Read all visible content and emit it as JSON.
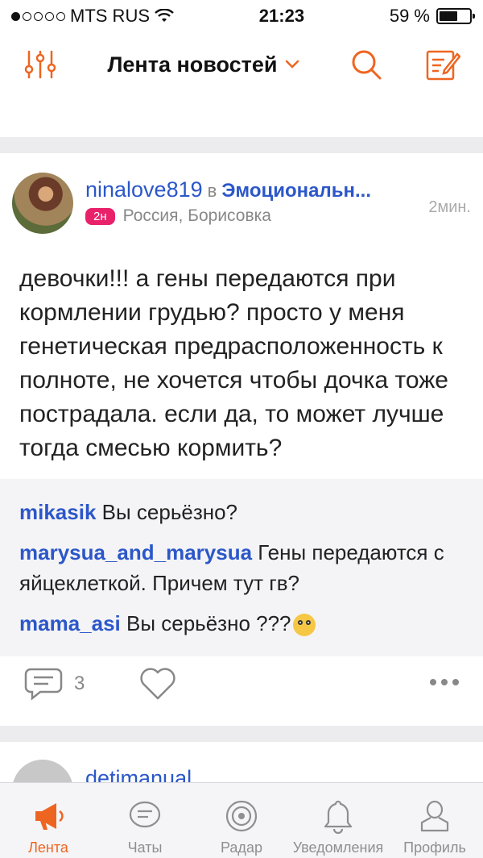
{
  "statusbar": {
    "carrier": "MTS RUS",
    "time": "21:23",
    "battery": "59 %"
  },
  "navbar": {
    "title": "Лента новостей"
  },
  "post": {
    "author": "ninalove819",
    "in_label": "в",
    "group": "Эмоциональн...",
    "badge": "2н",
    "location": "Россия, Борисовка",
    "time": "2мин.",
    "text": "девочки!!! а гены передаются при кормлении грудью? просто у меня генетическая предрасположенность к полноте, не хочется чтобы дочка тоже пострадала. если да, то может лучше тогда смесью кормить?",
    "comments": [
      {
        "user": "mikasik",
        "text": "Вы серьёзно?"
      },
      {
        "user": "marysua_and_marysua",
        "text": "Гены передаются с яйцеклеткой. Причем тут гв?"
      },
      {
        "user": "mama_asi",
        "text": "Вы серьёзно ???"
      }
    ],
    "comment_count": "3"
  },
  "post2": {
    "author": "detimanual"
  },
  "tabbar": {
    "tabs": [
      {
        "label": "Лента"
      },
      {
        "label": "Чаты"
      },
      {
        "label": "Радар"
      },
      {
        "label": "Уведомления"
      },
      {
        "label": "Профиль"
      }
    ]
  },
  "colors": {
    "accent": "#ee6521",
    "link": "#2c57c9",
    "badge": "#e8216a"
  }
}
